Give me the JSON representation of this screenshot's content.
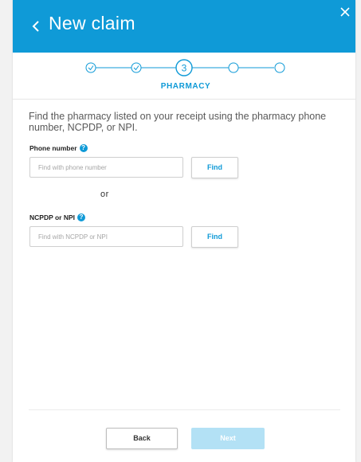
{
  "header": {
    "title": "New claim",
    "background": "#0f9ad7"
  },
  "stepper": {
    "current_step_number": "3",
    "current_step_label": "PHARMACY",
    "completed_steps": 2,
    "total_steps": 5
  },
  "instructions": "Find the pharmacy listed on your receipt using the pharmacy phone number, NCPDP, or NPI.",
  "phone_section": {
    "label": "Phone number",
    "help_icon": "?",
    "placeholder": "Find with phone number",
    "value": "",
    "button_label": "Find"
  },
  "separator_text": "or",
  "ncpdp_section": {
    "label": "NCPDP or NPI",
    "help_icon": "?",
    "placeholder": "Find with NCPDP or NPI",
    "value": "",
    "button_label": "Find"
  },
  "footer": {
    "back_label": "Back",
    "next_label": "Next",
    "next_disabled": true
  }
}
